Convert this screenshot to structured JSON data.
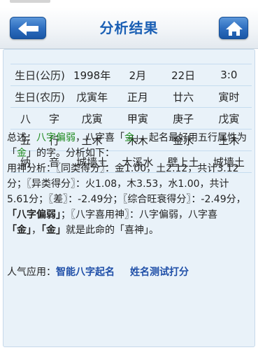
{
  "header": {
    "title": "分析结果",
    "back_icon": "back-arrow-icon",
    "home_icon": "home-icon"
  },
  "table": {
    "rows": [
      {
        "label": "生日(公历)",
        "cells": [
          "1998年",
          "2月",
          "22日",
          "3:0"
        ]
      },
      {
        "label": "生日(农历)",
        "cells": [
          "戊寅年",
          "正月",
          "廿六",
          "寅时"
        ]
      },
      {
        "label_a": "八",
        "label_b": "字",
        "cells": [
          "戊寅",
          "甲寅",
          "庚子",
          "戊寅"
        ]
      },
      {
        "label_a": "五",
        "label_b": "行",
        "cells": [
          "土木",
          "木木",
          "金水",
          "土木"
        ]
      },
      {
        "label_a": "纳",
        "label_b": "音",
        "cells": [
          "城墙土",
          "大溪水",
          "壁上土",
          "城墙土"
        ]
      }
    ]
  },
  "analysis": {
    "summary_prefix": "总述：",
    "summary_weak": "八字偏弱",
    "summary_mid": "，八字喜「",
    "summary_like": "金",
    "summary_mid2": "」，起名最好用五行属性为「",
    "summary_like2": "金",
    "summary_end": "」的字。分析如下：",
    "detail_1": "用神分析：〖同类得分〗：金1.00，土2.12，共计3.12分；〖异类得分〗：火1.08，木3.53，水1.00，共计5.61分；〖差〗：-2.49分；〖综合旺衰得分〗：-2.49分，",
    "detail_bold_1": "「八字偏弱」",
    "detail_2": "；〖八字喜用神〗：八字偏弱，八字喜",
    "detail_bold_2": "「金」",
    "detail_3": "，",
    "detail_bold_3": "「金」",
    "detail_4": "就是此命的「喜神」。"
  },
  "footer": {
    "prefix": "人气应用：",
    "link1": "智能八字起名",
    "link2": "姓名测试打分"
  },
  "colors": {
    "accent": "#1a5fb4",
    "panel": "#e9f2f9",
    "highlight": "#1f8a1f",
    "link": "#1f4fa8"
  }
}
